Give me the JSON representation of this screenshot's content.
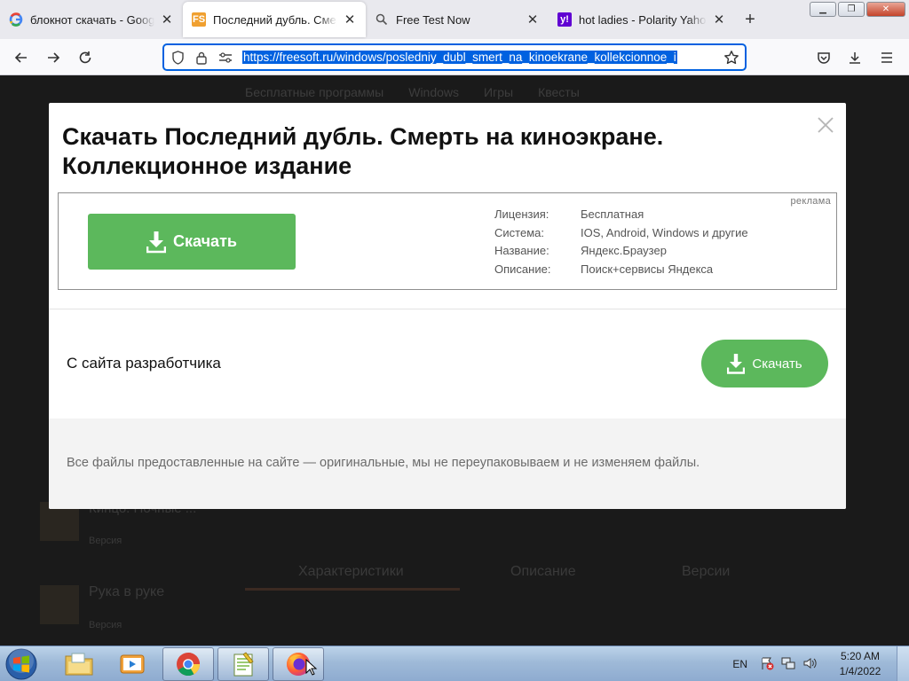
{
  "browser": {
    "tabs": [
      {
        "title": "блокнот скачать - Google Se",
        "favicon": "google-icon",
        "active": false
      },
      {
        "title": "Последний дубль. Смерть н",
        "favicon": "freesoft-icon",
        "favicon_text": "FS",
        "active": true
      },
      {
        "title": "Free Test Now",
        "favicon": "search-icon",
        "active": false
      },
      {
        "title": "hot ladies - Polarity Yahoo Se",
        "favicon": "yahoo-icon",
        "favicon_text": "y!",
        "active": false
      }
    ],
    "url": "https://freesoft.ru/windows/posledniy_dubl_smert_na_kinoekrane_kollekcionnoe_i"
  },
  "background_page": {
    "nav": [
      "Бесплатные программы",
      "Windows",
      "Игры",
      "Квесты"
    ],
    "items": [
      {
        "title": "Кинцо. Ночные ...",
        "sub": "Версия"
      },
      {
        "title": "Рука в руке",
        "sub": "Версия"
      }
    ],
    "tabs": [
      "Характеристики",
      "Описание",
      "Версии"
    ]
  },
  "modal": {
    "title": "Скачать Последний дубль. Смерть на киноэкране. Коллекционное издание",
    "ad": {
      "label": "реклама",
      "button": "Скачать",
      "info": [
        {
          "key": "Лицензия:",
          "value": "Бесплатная"
        },
        {
          "key": "Система:",
          "value": "IOS, Android, Windows и другие"
        },
        {
          "key": "Название:",
          "value": "Яндекс.Браузер"
        },
        {
          "key": "Описание:",
          "value": "Поиск+сервисы Яндекса"
        }
      ]
    },
    "developer": {
      "label": "С сайта разработчика",
      "button": "Скачать"
    },
    "footer": "Все файлы предоставленные на сайте — оригинальные, мы не переупаковываем и не изменяем файлы."
  },
  "taskbar": {
    "language": "EN",
    "time": "5:20 AM",
    "date": "1/4/2022"
  },
  "colors": {
    "accent_green": "#5cb85c",
    "url_highlight": "#0061e0"
  }
}
